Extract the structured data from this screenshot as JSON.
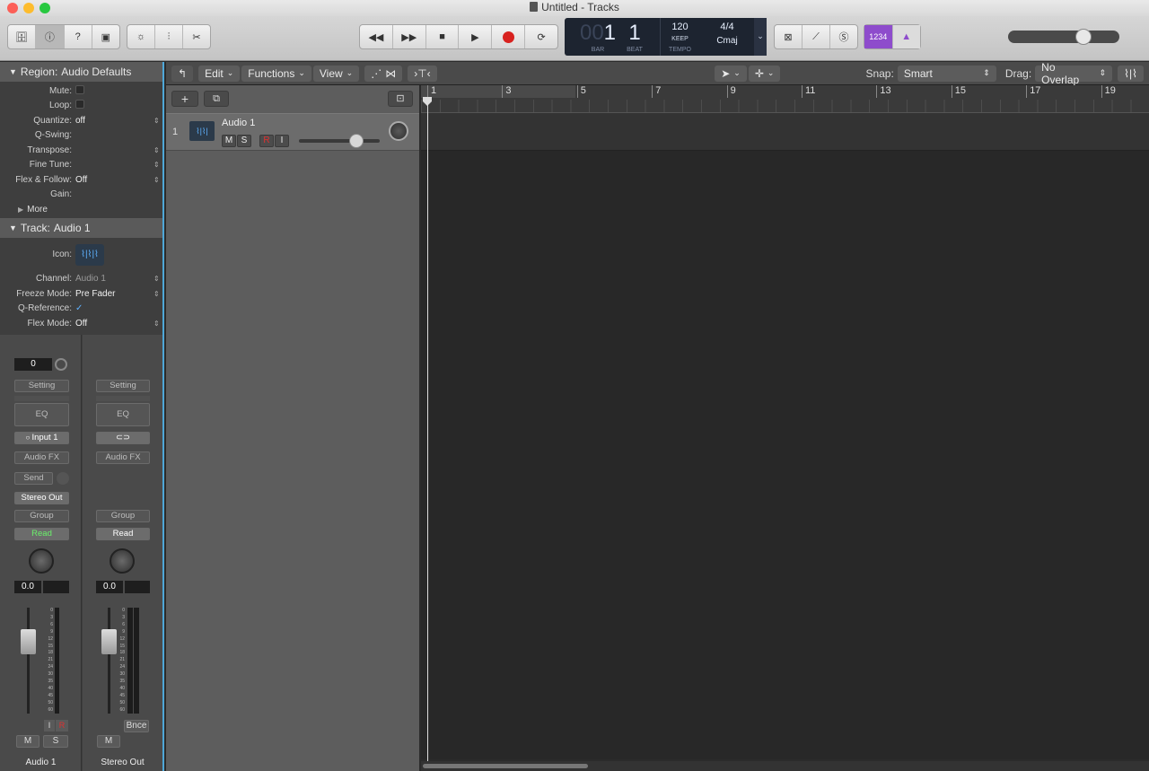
{
  "window": {
    "title": "Untitled - Tracks"
  },
  "transport": {
    "bar_label": "BAR",
    "beat_label": "BEAT",
    "tempo_label": "TEMPO",
    "bar_prefix": "00",
    "bar": "1",
    "beat": "1",
    "tempo": "120",
    "tempo_mode": "KEEP",
    "signature": "4/4",
    "key": "Cmaj",
    "count_in": "1234"
  },
  "region_inspector": {
    "title_prefix": "Region:",
    "title": "Audio Defaults",
    "rows": [
      {
        "k": "Mute:",
        "v": ""
      },
      {
        "k": "Loop:",
        "v": ""
      },
      {
        "k": "Quantize:",
        "v": "off"
      },
      {
        "k": "Q-Swing:",
        "v": ""
      },
      {
        "k": "Transpose:",
        "v": ""
      },
      {
        "k": "Fine Tune:",
        "v": ""
      },
      {
        "k": "Flex & Follow:",
        "v": "Off"
      },
      {
        "k": "Gain:",
        "v": ""
      }
    ],
    "more": "More"
  },
  "track_inspector": {
    "title_prefix": "Track:",
    "title": "Audio 1",
    "icon_label": "Icon:",
    "rows": [
      {
        "k": "Channel:",
        "v": "Audio 1"
      },
      {
        "k": "Freeze Mode:",
        "v": "Pre Fader"
      },
      {
        "k": "Q-Reference:",
        "v": "✓"
      },
      {
        "k": "Flex Mode:",
        "v": "Off"
      }
    ]
  },
  "strips": {
    "left": {
      "gain": "0",
      "setting": "Setting",
      "eq": "EQ",
      "input": "Input 1",
      "audio_fx": "Audio FX",
      "send": "Send",
      "output": "Stereo Out",
      "group": "Group",
      "automation": "Read",
      "pan_value": "0.0",
      "btn_i": "I",
      "btn_r": "R",
      "btn_m": "M",
      "btn_s": "S",
      "name": "Audio 1"
    },
    "right": {
      "setting": "Setting",
      "eq": "EQ",
      "audio_fx": "Audio FX",
      "group": "Group",
      "automation": "Read",
      "pan_value": "0.0",
      "bounce": "Bnce",
      "btn_m": "M",
      "name": "Stereo Out"
    },
    "meter_scale": [
      "0",
      "3",
      "6",
      "9",
      "12",
      "15",
      "18",
      "21",
      "24",
      "30",
      "35",
      "40",
      "45",
      "50",
      "60"
    ]
  },
  "local_bar": {
    "edit": "Edit",
    "functions": "Functions",
    "view": "View",
    "snap_label": "Snap:",
    "snap_value": "Smart",
    "drag_label": "Drag:",
    "drag_value": "No Overlap"
  },
  "track": {
    "number": "1",
    "name": "Audio 1",
    "m": "M",
    "s": "S",
    "r": "R",
    "i": "I"
  },
  "ruler": {
    "bars": [
      "1",
      "3",
      "5",
      "7",
      "9",
      "11",
      "13",
      "15",
      "17",
      "19"
    ]
  }
}
